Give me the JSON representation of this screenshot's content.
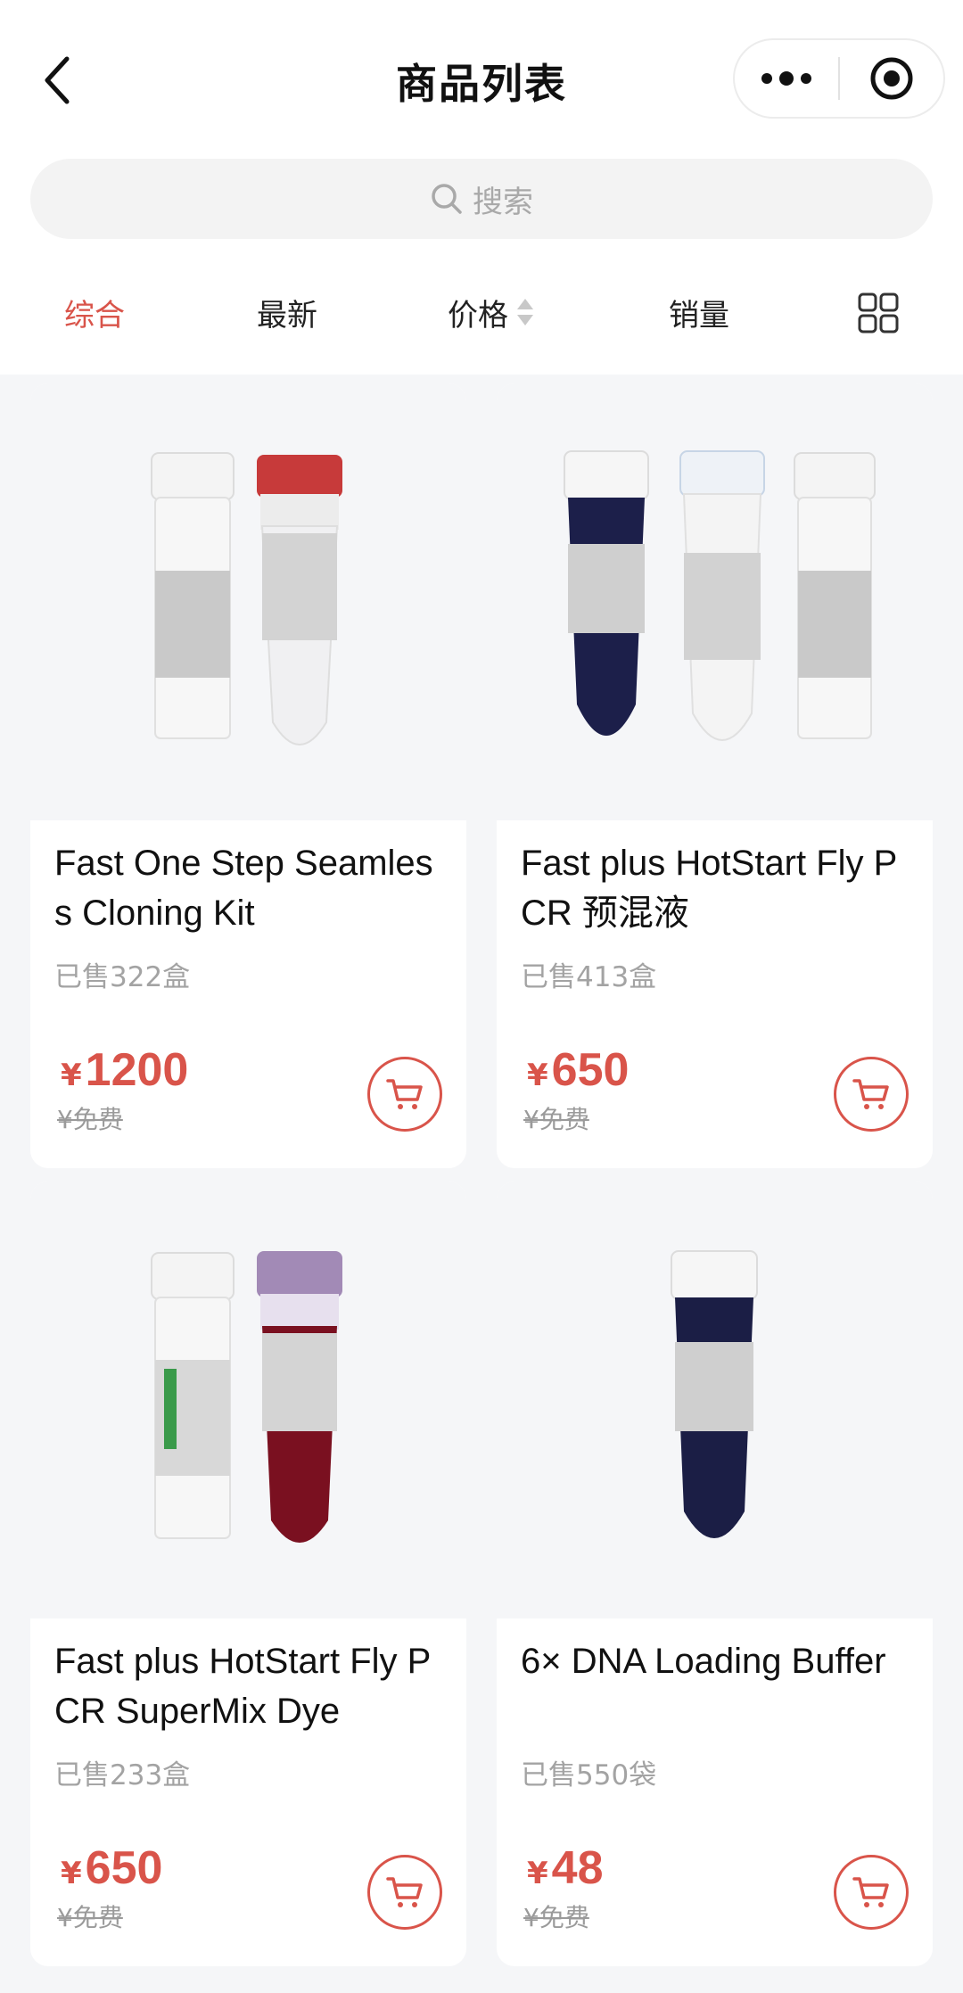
{
  "header": {
    "title": "商品列表",
    "back_icon": "chevron-left-icon",
    "more_icon": "more-dots-icon",
    "close_icon": "target-circle-icon"
  },
  "search": {
    "placeholder": "搜索",
    "icon": "search-icon"
  },
  "tabs": [
    {
      "label": "综合",
      "active": true
    },
    {
      "label": "最新",
      "active": false
    },
    {
      "label": "价格",
      "active": false,
      "sortable": true
    },
    {
      "label": "销量",
      "active": false
    }
  ],
  "layout_toggle_icon": "grid-layout-icon",
  "colors": {
    "accent": "#d9544a",
    "muted": "#a3a3a3",
    "page_bg": "#f5f6f8"
  },
  "products": [
    {
      "name": "Fast One Step Seamless Cloning Kit",
      "sold": "已售322盒",
      "currency": "¥",
      "price": "1200",
      "original_price": "¥免费",
      "cart_icon": "cart-icon"
    },
    {
      "name": "Fast plus HotStart Fly PCR 预混液",
      "sold": "已售413盒",
      "currency": "¥",
      "price": "650",
      "original_price": "¥免费",
      "cart_icon": "cart-icon"
    },
    {
      "name": "Fast plus HotStart Fly PCR SuperMix Dye",
      "sold": "已售233盒",
      "currency": "¥",
      "price": "650",
      "original_price": "¥免费",
      "cart_icon": "cart-icon"
    },
    {
      "name": "6× DNA Loading Buffer",
      "sold": "已售550袋",
      "currency": "¥",
      "price": "48",
      "original_price": "¥免费",
      "cart_icon": "cart-icon"
    }
  ]
}
